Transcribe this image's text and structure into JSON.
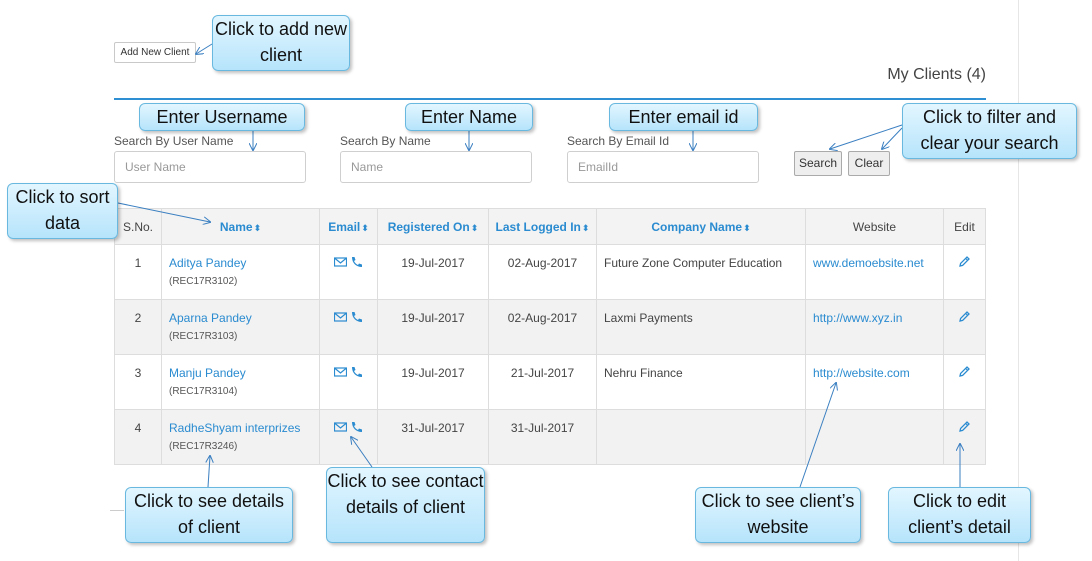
{
  "toolbar": {
    "add_client_label": "Add New Client"
  },
  "page_title": "My Clients (4)",
  "search": {
    "username": {
      "label": "Search By User Name",
      "placeholder": "User Name"
    },
    "name": {
      "label": "Search By Name",
      "placeholder": "Name"
    },
    "email": {
      "label": "Search By Email Id",
      "placeholder": "EmailId"
    },
    "search_button": "Search",
    "clear_button": "Clear"
  },
  "table": {
    "headers": {
      "sno": "S.No.",
      "name": "Name",
      "email": "Email",
      "registered_on": "Registered On",
      "last_logged_in": "Last Logged In",
      "company_name": "Company Name",
      "website": "Website",
      "edit": "Edit"
    },
    "sort_glyph": "⬍",
    "rows": [
      {
        "sno": "1",
        "name": "Aditya Pandey",
        "id": "(REC17R3102)",
        "registered_on": "19-Jul-2017",
        "last_logged_in": "02-Aug-2017",
        "company": "Future Zone Computer Education",
        "website": "www.demoebsite.net"
      },
      {
        "sno": "2",
        "name": "Aparna Pandey",
        "id": "(REC17R3103)",
        "registered_on": "19-Jul-2017",
        "last_logged_in": "02-Aug-2017",
        "company": "Laxmi Payments",
        "website": "http://www.xyz.in"
      },
      {
        "sno": "3",
        "name": "Manju Pandey",
        "id": "(REC17R3104)",
        "registered_on": "19-Jul-2017",
        "last_logged_in": "21-Jul-2017",
        "company": "Nehru Finance",
        "website": "http://website.com"
      },
      {
        "sno": "4",
        "name": "RadheShyam interprizes",
        "id": "(REC17R3246)",
        "registered_on": "31-Jul-2017",
        "last_logged_in": "31-Jul-2017",
        "company": "",
        "website": ""
      }
    ]
  },
  "icons": {
    "email": "envelope-icon",
    "phone": "phone-icon",
    "edit": "pencil-icon"
  },
  "callouts": {
    "add_client": "Click to add new client",
    "username": "Enter Username",
    "name": "Enter Name",
    "email": "Enter email id",
    "filter": "Click to filter and clear your search",
    "sort": "Click to sort data",
    "client_details": "Click to see details of client",
    "contact_details": "Click to see contact details of client",
    "website": "Click to see client’s website",
    "edit": "Click to edit client’s detail"
  },
  "colors": {
    "accent": "#2a8bd0",
    "rule": "#2f8fd3",
    "callout_bg": "#c9ecfd",
    "callout_border": "#69b8df",
    "row_alt": "#f2f2f2"
  }
}
